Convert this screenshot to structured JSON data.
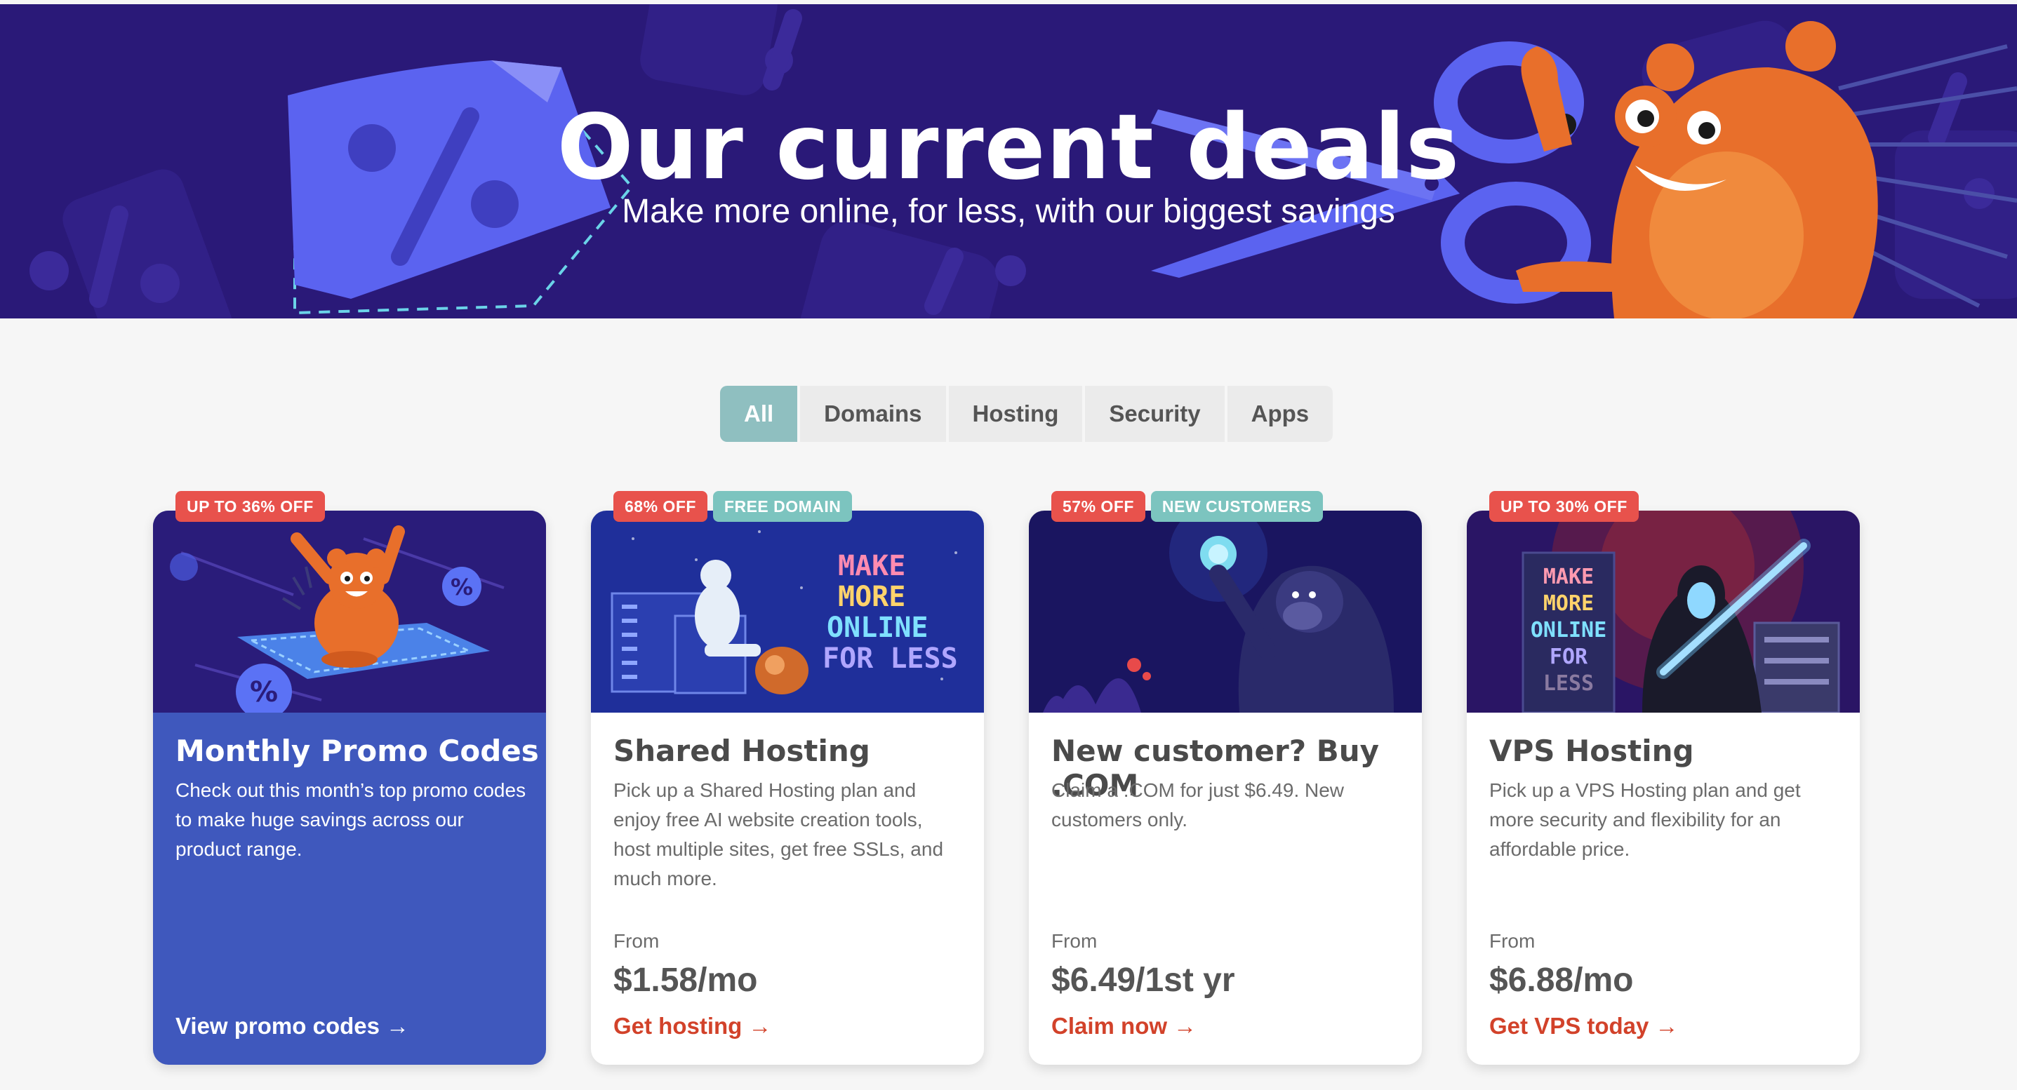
{
  "hero": {
    "title": "Our current deals",
    "subtitle": "Make more online, for less, with our biggest savings"
  },
  "filters": {
    "tabs": [
      {
        "label": "All",
        "active": true
      },
      {
        "label": "Domains",
        "active": false
      },
      {
        "label": "Hosting",
        "active": false
      },
      {
        "label": "Security",
        "active": false
      },
      {
        "label": "Apps",
        "active": false
      }
    ]
  },
  "cards": [
    {
      "badges": [
        "UP TO 36% OFF"
      ],
      "title": "Monthly Promo Codes",
      "description": "Check out this month’s top promo codes to make huge savings across our product range.",
      "from": "",
      "price": "",
      "cta": "View promo codes →"
    },
    {
      "badges": [
        "68% OFF",
        "FREE DOMAIN"
      ],
      "title": "Shared Hosting",
      "description": "Pick up a Shared Hosting plan and enjoy free AI website creation tools, host multiple sites, get free SSLs, and much more.",
      "from": "From",
      "price": "$1.58/mo",
      "cta": "Get hosting →"
    },
    {
      "badges": [
        "57% OFF",
        "NEW CUSTOMERS"
      ],
      "title": "New customer? Buy .COM",
      "description": "Claim a .COM for just $6.49. New customers only.",
      "from": "From",
      "price": "$6.49/1st yr",
      "cta": "Claim now →"
    },
    {
      "badges": [
        "UP TO 30% OFF"
      ],
      "title": "VPS Hosting",
      "description": "Pick up a VPS Hosting plan and get more security and flexibility for an affordable price.",
      "from": "From",
      "price": "$6.88/mo",
      "cta": "Get VPS today →"
    }
  ],
  "colors": {
    "hero_bg": "#2a1978",
    "active_tab": "#8fbfc0",
    "badge_red": "#e8524c",
    "badge_teal": "#7cc4bf",
    "cta_red": "#d2422a",
    "promo_card": "#3f58bd"
  },
  "art": {
    "shared_hosting_sign": [
      "MAKE",
      "MORE",
      "ONLINE",
      "FOR LESS"
    ],
    "vps_sign": [
      "MAKE",
      "MORE",
      "ONLINE",
      "FOR",
      "LESS"
    ]
  }
}
